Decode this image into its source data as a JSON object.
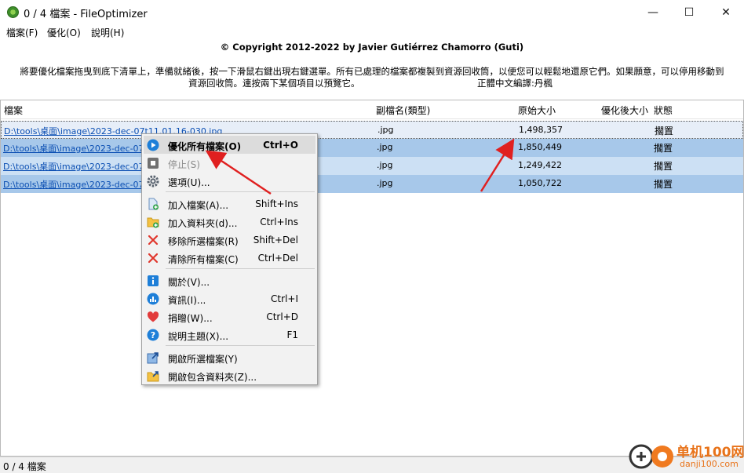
{
  "window": {
    "title": "0 / 4 檔案 - FileOptimizer",
    "minimize_icon": "—",
    "maximize_icon": "☐",
    "close_icon": "✕"
  },
  "menubar": {
    "items": [
      {
        "label": "檔案(F)"
      },
      {
        "label": "優化(O)"
      },
      {
        "label": "說明(H)"
      }
    ]
  },
  "header": {
    "copyright": "© Copyright 2012-2022 by Javier Gutiérrez Chamorro (Guti)",
    "instructions_line1": "將要優化檔案拖曳到底下清單上，準備就緒後，按一下滑鼠右鍵出現右鍵選單。所有已處理的檔案都複製到資源回收筒，以便您可以輕鬆地還原它們。如果願意，可以停用移動到",
    "instructions_line2": "資源回收筒。連按兩下某個項目以預覽它。",
    "translator": "正體中文編譯:丹楓"
  },
  "list": {
    "columns": [
      "檔案",
      "副檔名(類型)",
      "原始大小",
      "優化後大小",
      "狀態"
    ],
    "rows": [
      {
        "path": "D:\\tools\\桌面\\image\\2023-dec-07t11.01.16-030.jpg",
        "ext": ".jpg",
        "original_size": "1,498,357",
        "optimized_size": "",
        "status": "擱置"
      },
      {
        "path": "D:\\tools\\桌面\\image\\2023-dec-07t1",
        "ext": ".jpg",
        "original_size": "1,850,449",
        "optimized_size": "",
        "status": "擱置"
      },
      {
        "path": "D:\\tools\\桌面\\image\\2023-dec-07t1",
        "ext": ".jpg",
        "original_size": "1,249,422",
        "optimized_size": "",
        "status": "擱置"
      },
      {
        "path": "D:\\tools\\桌面\\image\\2023-dec-07t1",
        "ext": ".jpg",
        "original_size": "1,050,722",
        "optimized_size": "",
        "status": "擱置"
      }
    ]
  },
  "context_menu": {
    "items": [
      {
        "label": "優化所有檔案(O)",
        "shortcut": "Ctrl+O",
        "icon": "play-icon"
      },
      {
        "label": "停止(S)",
        "shortcut": "",
        "icon": "stop-icon"
      },
      {
        "label": "選項(U)...",
        "shortcut": "",
        "icon": "gear-icon"
      },
      {
        "label": "加入檔案(A)...",
        "shortcut": "Shift+Ins",
        "icon": "add-file-icon"
      },
      {
        "label": "加入資料夾(d)...",
        "shortcut": "Ctrl+Ins",
        "icon": "add-folder-icon"
      },
      {
        "label": "移除所選檔案(R)",
        "shortcut": "Shift+Del",
        "icon": "remove-icon"
      },
      {
        "label": "清除所有檔案(C)",
        "shortcut": "Ctrl+Del",
        "icon": "clear-icon"
      },
      {
        "label": "關於(V)...",
        "shortcut": "",
        "icon": "info-icon"
      },
      {
        "label": "資訊(I)...",
        "shortcut": "Ctrl+I",
        "icon": "stats-icon"
      },
      {
        "label": "捐贈(W)...",
        "shortcut": "Ctrl+D",
        "icon": "heart-icon"
      },
      {
        "label": "說明主題(X)...",
        "shortcut": "F1",
        "icon": "help-icon"
      },
      {
        "label": "開啟所選檔案(Y)",
        "shortcut": "",
        "icon": "open-file-icon"
      },
      {
        "label": "開啟包含資料夾(Z)...",
        "shortcut": "",
        "icon": "open-folder-icon"
      }
    ]
  },
  "statusbar": {
    "text": "0 / 4 檔案"
  },
  "watermark": {
    "brand": "单机100网",
    "domain": "danji100.com"
  },
  "colors": {
    "selection": "#cce0f4",
    "selection_dark": "#a7c8ea",
    "link": "#0b4fb3",
    "annotation_arrow": "#e02020",
    "menu_bg": "#f2f2f2"
  }
}
